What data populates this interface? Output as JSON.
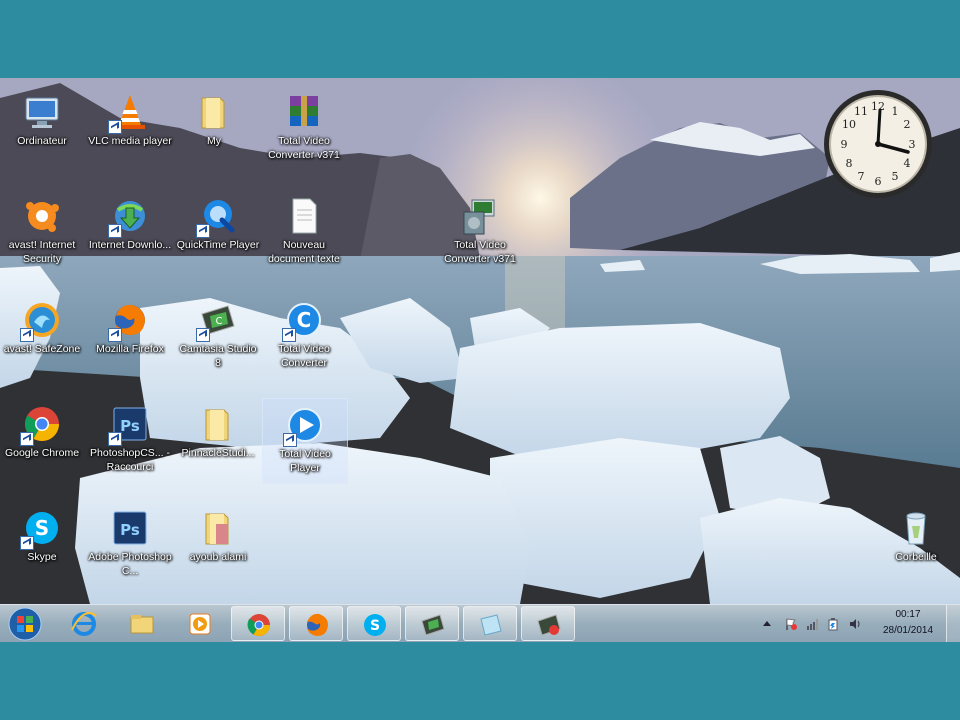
{
  "desktop": {
    "icons": [
      {
        "label": "Ordinateur"
      },
      {
        "label": "VLC media player"
      },
      {
        "label": "My"
      },
      {
        "label": "Total Video Converter v371"
      },
      {
        "label": "avast! Internet Security"
      },
      {
        "label": "Internet Downlo..."
      },
      {
        "label": "QuickTime Player"
      },
      {
        "label": "Nouveau document texte"
      },
      {
        "label": "Total Video Converter v371"
      },
      {
        "label": "avast! SafeZone"
      },
      {
        "label": "Mozilla Firefox"
      },
      {
        "label": "Camtasia Studio 8"
      },
      {
        "label": "Total Video Converter"
      },
      {
        "label": "Google Chrome"
      },
      {
        "label": "PhotoshopCS... - Raccourci"
      },
      {
        "label": "PinnacleStudi..."
      },
      {
        "label": "Total Video Player"
      },
      {
        "label": "Skype"
      },
      {
        "label": "Adobe Photoshop C..."
      },
      {
        "label": "ayoub alami"
      },
      {
        "label": "Corbeille"
      }
    ]
  },
  "taskbar": {
    "time": "00:17",
    "date": "28/01/2014"
  },
  "colors": {
    "frame": "#2e8ca1",
    "taskbar": "#a9c3d2"
  }
}
